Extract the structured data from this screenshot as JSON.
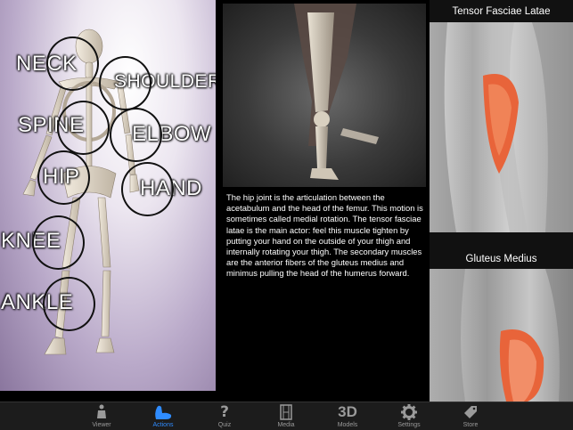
{
  "joints": {
    "neck": "NECK",
    "shoulder": "SHOULDER",
    "spine": "SPINE",
    "elbow": "ELBOW",
    "hip": "HIP",
    "hand": "HAND",
    "knee": "KNEE",
    "ankle": "ANKLE"
  },
  "description": "The hip joint is the articulation between the acetabulum and the head of the femur. This motion is sometimes called medial rotation. The tensor fasciae latae is the main actor: feel this muscle tighten by putting your hand on the outside of your thigh and internally rotating your thigh. The secondary muscles are the anterior fibers of the gluteus medius and minimus pulling the head of the humerus forward.",
  "muscles": [
    {
      "title": "Tensor Fasciae Latae"
    },
    {
      "title": "Gluteus Medius"
    }
  ],
  "tabs": [
    {
      "label": "Viewer",
      "icon": "person-icon"
    },
    {
      "label": "Actions",
      "icon": "foot-icon"
    },
    {
      "label": "Quiz",
      "icon": "question-icon"
    },
    {
      "label": "Media",
      "icon": "film-icon"
    },
    {
      "label": "Models",
      "icon": "3d-icon",
      "icon_text": "3D"
    },
    {
      "label": "Settings",
      "icon": "gear-icon"
    },
    {
      "label": "Store",
      "icon": "tag-icon"
    }
  ],
  "active_tab": "Actions",
  "colors": {
    "accent": "#2f8cff",
    "muscle_highlight": "#e8643a"
  }
}
